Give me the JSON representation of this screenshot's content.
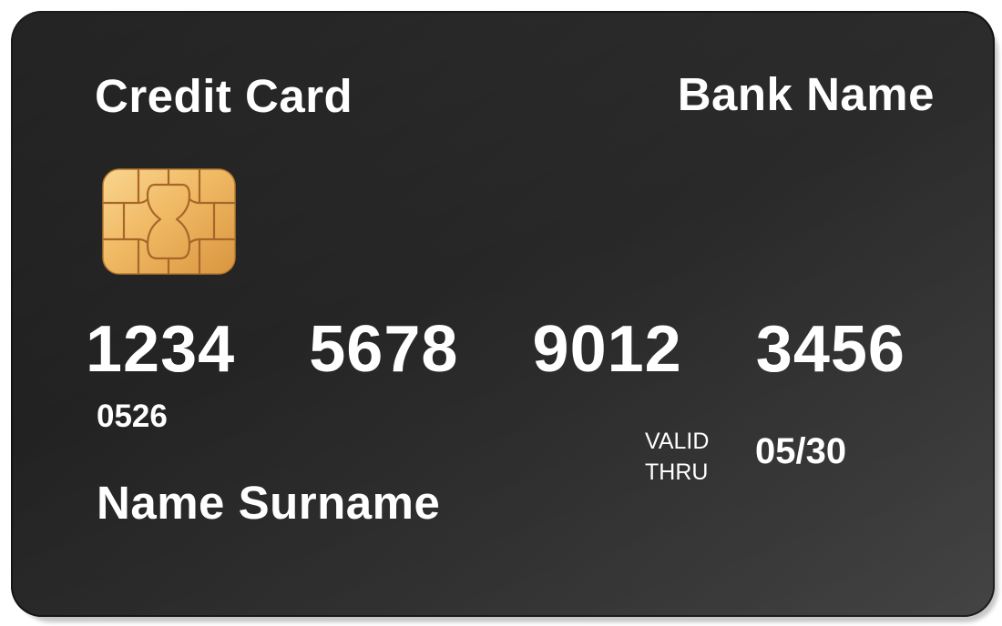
{
  "card": {
    "type_label": "Credit Card",
    "bank_name": "Bank Name",
    "number_groups": [
      "1234",
      "5678",
      "9012",
      "3456"
    ],
    "small_code": "0526",
    "valid_thru_line1": "VALID",
    "valid_thru_line2": "THRU",
    "expiry": "05/30",
    "holder_name": "Name Surname",
    "chip_icon": "emv-chip-icon"
  },
  "colors": {
    "card_background": "#232323",
    "text": "#ffffff",
    "chip_gold_light": "#f6c77a",
    "chip_gold_dark": "#c88a3a",
    "chip_lines": "#a8672a"
  }
}
